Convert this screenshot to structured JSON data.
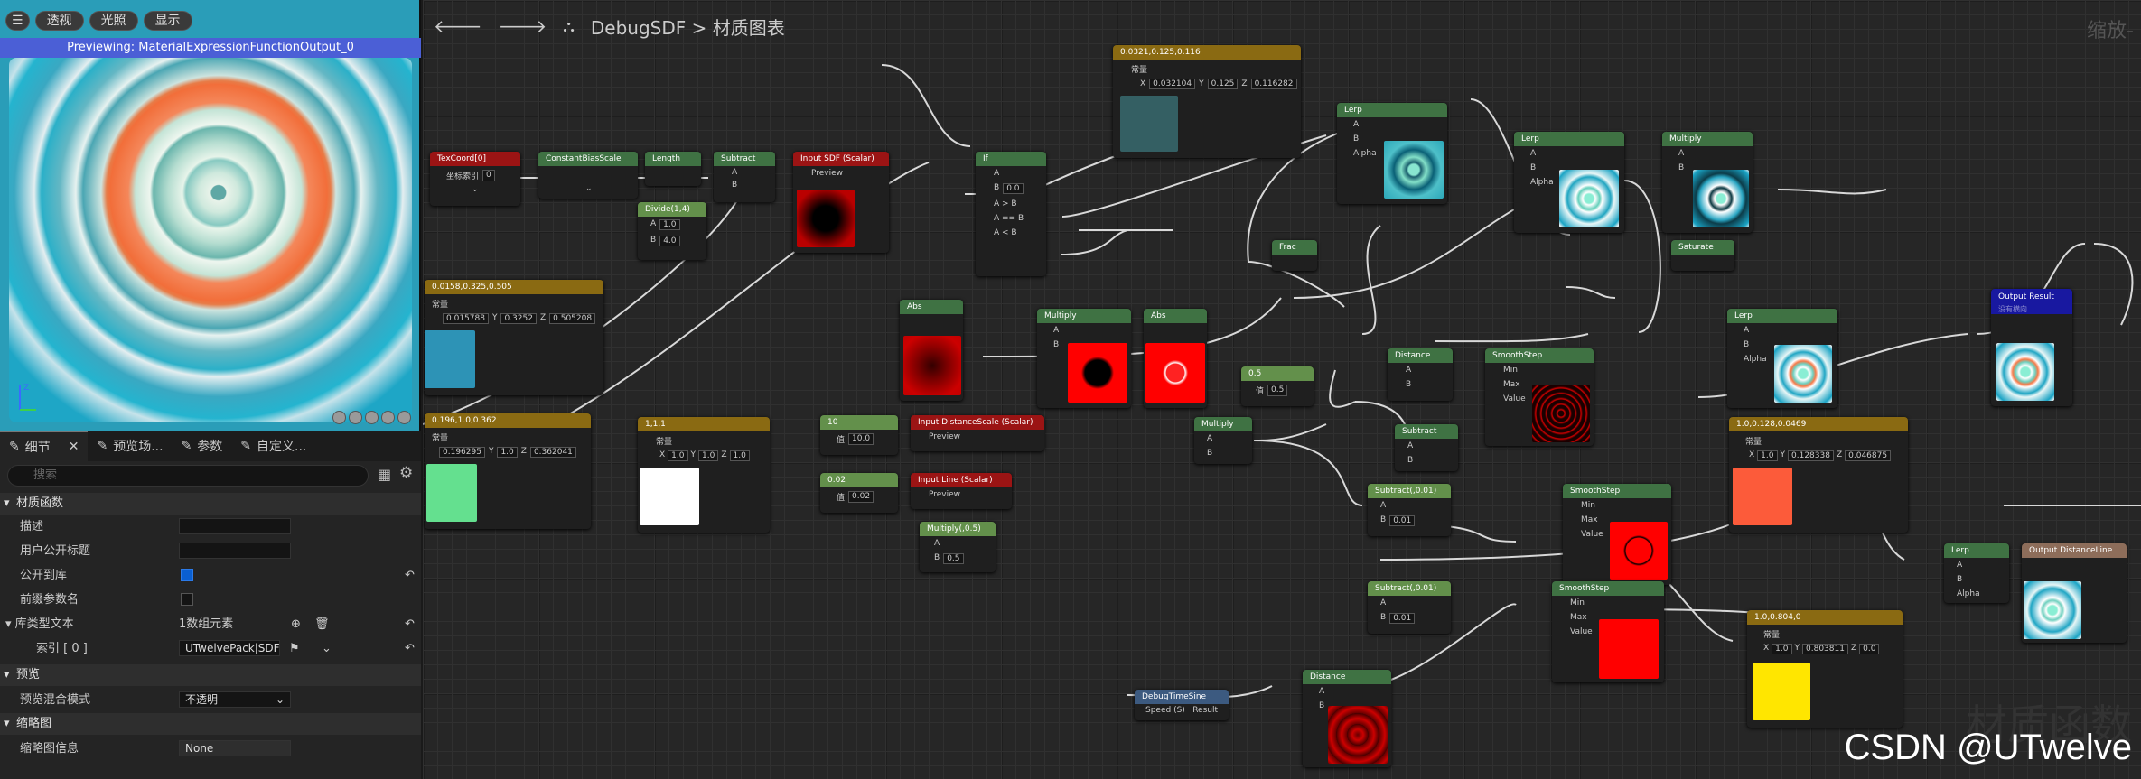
{
  "preview": {
    "buttons": [
      "透视",
      "光照",
      "显示"
    ],
    "title": "Previewing: MaterialExpressionFunctionOutput_0"
  },
  "details": {
    "tabs": [
      "细节",
      "预览场...",
      "参数",
      "自定义..."
    ],
    "search_placeholder": "搜索",
    "sections": {
      "material_function": "材质函数",
      "preview": "预览",
      "thumbnail": "缩略图"
    },
    "rows": {
      "description": "描述",
      "user_exposed_caption": "用户公开标题",
      "expose_to_library": "公开到库",
      "prefix_param_names": "前缀参数名",
      "library_category_text": "库类型文本",
      "library_category_value": "1数组元素",
      "index": "索引 [ 0 ]",
      "index_value": "UTwelvePack|SDF",
      "preview_blend_mode": "预览混合模式",
      "preview_blend_value": "不透明",
      "thumbnail_info": "缩略图信息",
      "thumbnail_value": "None"
    }
  },
  "graph": {
    "breadcrumb_asset": "DebugSDF",
    "breadcrumb_sep": ">",
    "breadcrumb_page": "材质图表",
    "zoom": "缩放-"
  },
  "nodes": {
    "const3_top": {
      "title": "0.0321,0.125,0.116",
      "label": "常量",
      "x": "0.032104",
      "y": "0.125",
      "z": "0.116282"
    },
    "const3_mid": {
      "title": "0.0158,0.325,0.505",
      "label": "常量",
      "x": "0.015788",
      "y": "0.3252",
      "z": "0.505208"
    },
    "const3_low": {
      "title": "0.196,1.0,0.362",
      "label": "常量",
      "x": "0.196295",
      "y": "1.0",
      "z": "0.362041"
    },
    "const3_white": {
      "title": "1,1,1",
      "label": "常量",
      "x": "1.0",
      "y": "1.0",
      "z": "1.0"
    },
    "const3_orange": {
      "title": "1.0,0.128,0.0469",
      "label": "常量",
      "x": "1.0",
      "y": "0.128338",
      "z": "0.046875"
    },
    "const3_yellow": {
      "title": "1.0,0.804,0",
      "label": "常量",
      "x": "1.0",
      "y": "0.803811",
      "z": "0.0"
    },
    "texcoord": {
      "title": "TexCoord[0]",
      "label": "坐标索引",
      "value": "0"
    },
    "cbs": {
      "title": "ConstantBiasScale"
    },
    "length": {
      "title": "Length"
    },
    "subtract1": {
      "title": "Subtract",
      "a": "A",
      "b": "B"
    },
    "divide": {
      "title": "Divide(1,4)",
      "a": "1.0",
      "b": "4.0"
    },
    "input_sdf": {
      "title": "Input SDF (Scalar)",
      "preview": "Preview"
    },
    "if": {
      "title": "If",
      "b": "0.0",
      "agb": "A > B",
      "aeb": "A == B",
      "alb": "A < B"
    },
    "lerp1": {
      "title": "Lerp",
      "alpha": "Alpha"
    },
    "lerp2": {
      "title": "Lerp",
      "alpha": "Alpha"
    },
    "lerp3": {
      "title": "Lerp",
      "alpha": "Alpha"
    },
    "lerp4": {
      "title": "Lerp",
      "alpha": "Alpha"
    },
    "multiply1": {
      "title": "Multiply"
    },
    "multiply2": {
      "title": "Multiply"
    },
    "multiply3": {
      "title": "Multiply"
    },
    "multiply_05": {
      "title": "Multiply(,0.5)",
      "b": "0.5"
    },
    "abs1": {
      "title": "Abs"
    },
    "abs2": {
      "title": "Abs"
    },
    "frac": {
      "title": "Frac"
    },
    "saturate": {
      "title": "Saturate"
    },
    "distance1": {
      "title": "Distance"
    },
    "distance2": {
      "title": "Distance"
    },
    "smoothstep1": {
      "title": "SmoothStep",
      "min": "Min",
      "max": "Max",
      "value": "Value"
    },
    "smoothstep2": {
      "title": "SmoothStep",
      "min": "Min",
      "max": "Max",
      "value": "Value"
    },
    "smoothstep3": {
      "title": "SmoothStep",
      "min": "Min",
      "max": "Max",
      "value": "Value"
    },
    "subtract2": {
      "title": "Subtract"
    },
    "subtract_001a": {
      "title": "Subtract(,0.01)",
      "b": "0.01"
    },
    "subtract_001b": {
      "title": "Subtract(,0.01)",
      "b": "0.01"
    },
    "scalar_05": {
      "title": "0.5",
      "label": "值",
      "value": "0.5"
    },
    "scalar_10": {
      "title": "10",
      "label": "值",
      "value": "10.0"
    },
    "scalar_002": {
      "title": "0.02",
      "label": "值",
      "value": "0.02"
    },
    "input_distscale": {
      "title": "Input DistanceScale (Scalar)",
      "preview": "Preview"
    },
    "input_line": {
      "title": "Input Line (Scalar)",
      "preview": "Preview"
    },
    "output_result": {
      "title": "Output Result",
      "sub": "没有横向"
    },
    "output_distline": {
      "title": "Output DistanceLine"
    },
    "debug_time_sine": {
      "title": "DebugTimeSine",
      "speed": "Speed (S)",
      "result": "Result"
    }
  },
  "watermark": "CSDN @UTwelve",
  "watermark_bg": "材质函数"
}
